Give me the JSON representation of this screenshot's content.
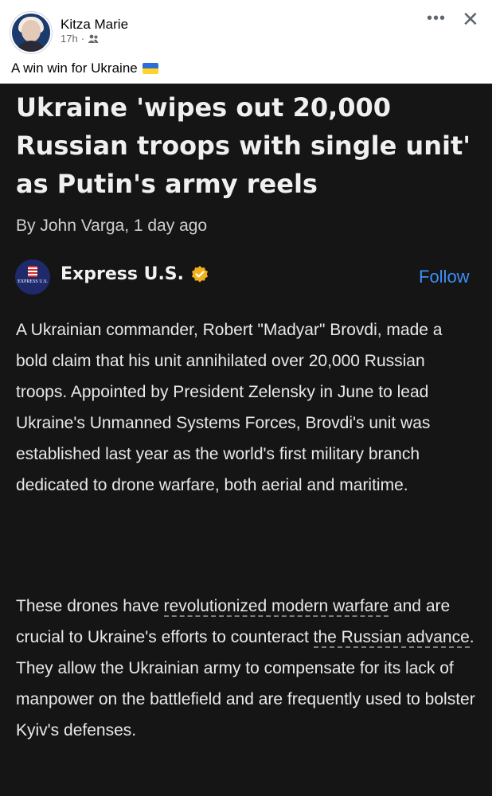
{
  "post": {
    "author": "Kitza Marie",
    "time": "17h",
    "separator": "·",
    "audience_icon": "people-icon",
    "text": "A win win for Ukraine",
    "emoji": "ukraine-flag",
    "more_icon": "•••",
    "close_icon": "✕"
  },
  "article": {
    "headline": "Ukraine 'wipes out 20,000 Russian troops with single unit' as Putin's army reels",
    "byline": "By John Varga,  1 day ago",
    "source_name": "Express U.S.",
    "source_logo_text": "EXPRESS U.S.",
    "follow_label": "Follow",
    "paragraph1": "A Ukrainian commander, Robert \"Madyar\" Brovdi, made a bold claim that his unit annihilated over 20,000 Russian troops. Appointed by President Zelensky in June to lead Ukraine's Unmanned Systems Forces, Brovdi's unit was established last year as the world's first military branch dedicated to drone warfare, both aerial and maritime.",
    "paragraph2_before": "These drones have ",
    "paragraph2_link1": "revolutionized modern warfare",
    "paragraph2_mid": " and are crucial to Ukraine's efforts to counteract ",
    "paragraph2_link2": "the Russian advance",
    "paragraph2_after": ". They allow the Ukrainian army to compensate for its lack of manpower on the battlefield and are frequently used to bolster Kyiv's defenses."
  },
  "colors": {
    "article_bg": "#151515",
    "follow": "#3d8ef7",
    "verified_badge": "#f2b01e"
  }
}
